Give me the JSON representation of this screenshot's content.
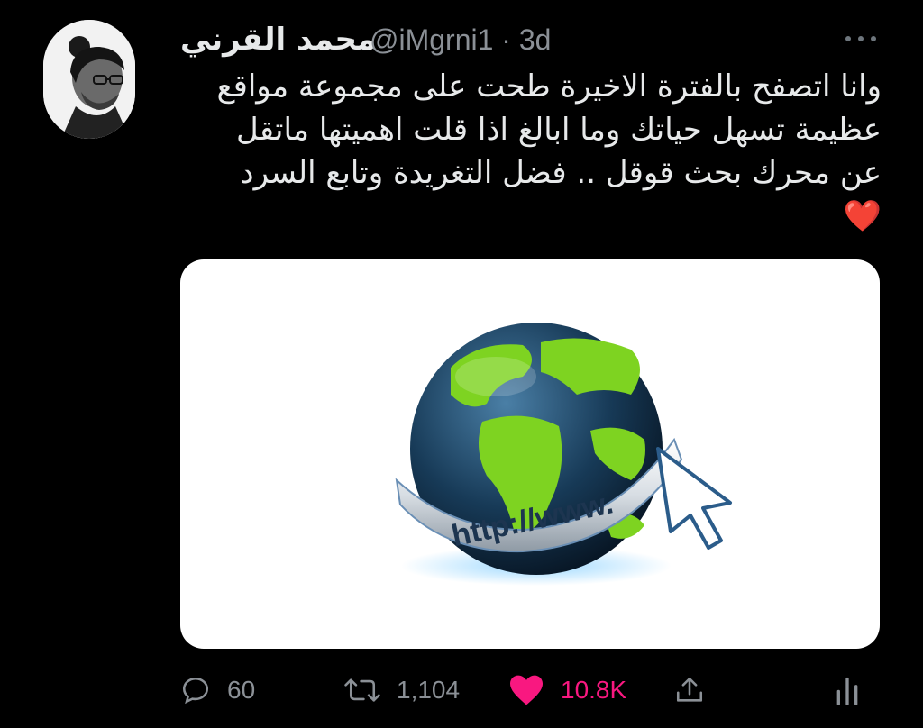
{
  "tweet": {
    "display_name": "محمد القرني",
    "handle_time": "@iMgrni1 · 3d",
    "text_lines": [
      "وانا اتصفح بالفترة الاخيرة طحت على مجموعة مواقع",
      "عظيمة تسهل حياتك وما ابالغ اذا قلت اهميتها ماتقل",
      "عن محرك بحث قوقل .. فضل التغريدة وتابع السرد",
      "❤️"
    ],
    "media": {
      "url_label": "http://www."
    }
  },
  "actions": {
    "replies": "60",
    "retweets": "1,104",
    "likes": "10.8K"
  },
  "colors": {
    "background": "#000000",
    "text": "#e7e9ea",
    "muted": "#8b9096",
    "like": "#f91880",
    "globe_green": "#7ed321"
  },
  "icons": {
    "more": "more-icon",
    "reply": "reply-icon",
    "retweet": "retweet-icon",
    "like": "heart-icon",
    "share": "share-icon",
    "analytics": "analytics-icon"
  }
}
